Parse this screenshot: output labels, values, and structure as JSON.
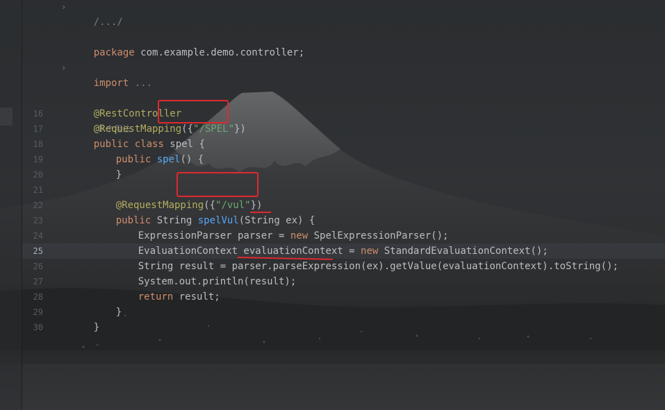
{
  "editor": {
    "gutter": {
      "line_numbers": [
        "16",
        "17",
        "18",
        "19",
        "20",
        "21",
        "22",
        "23",
        "24",
        "25",
        "26",
        "27",
        "28",
        "29",
        "30"
      ],
      "active_line": "25"
    },
    "code": {
      "folded_header": "/.../",
      "package_kw": "package",
      "package_name": " com.example.demo.controller;",
      "import_kw": "import",
      "import_folded": " ...",
      "rest_controller": "@RestController",
      "usage_hint": "0 个用法",
      "request_mapping": "@RequestMapping",
      "class_mapping_open": "({",
      "class_mapping_value": "\"/SPEL\"",
      "class_mapping_close": "})",
      "class_public": "public",
      "class_class": " class",
      "class_name": " spel {",
      "ctor_public": "public",
      "ctor_name": " spel",
      "ctor_rest": "() {",
      "ctor_close": "}",
      "method_annotation": "@RequestMapping",
      "method_mapping_open": "({",
      "method_mapping_value": "\"/vul\"",
      "method_mapping_close": "})",
      "method_public": "public",
      "method_type": " String ",
      "method_name": "spelVul",
      "method_params": "(String ex) {",
      "l23_a": "ExpressionParser parser = ",
      "l23_new": "new",
      "l23_b": " SpelExpressionParser();",
      "l24_a": "EvaluationContext evaluationContext = ",
      "l24_new": "new",
      "l24_b": " StandardEvaluationContext();",
      "l25": "String result = parser.parseExpression(ex).getValue(evaluationContext).toString();",
      "l26": "System.out.println(result);",
      "l27_kw": "return",
      "l27_rest": " result;",
      "method_close": "}",
      "class_close": "}"
    },
    "colors": {
      "keyword": "#cf8e6d",
      "annotation": "#b3ae60",
      "string": "#6aab73",
      "function": "#56a8f5",
      "text": "#bcbec4",
      "markup_red": "#e0292e"
    },
    "background_image": "mount-fuji-night"
  }
}
